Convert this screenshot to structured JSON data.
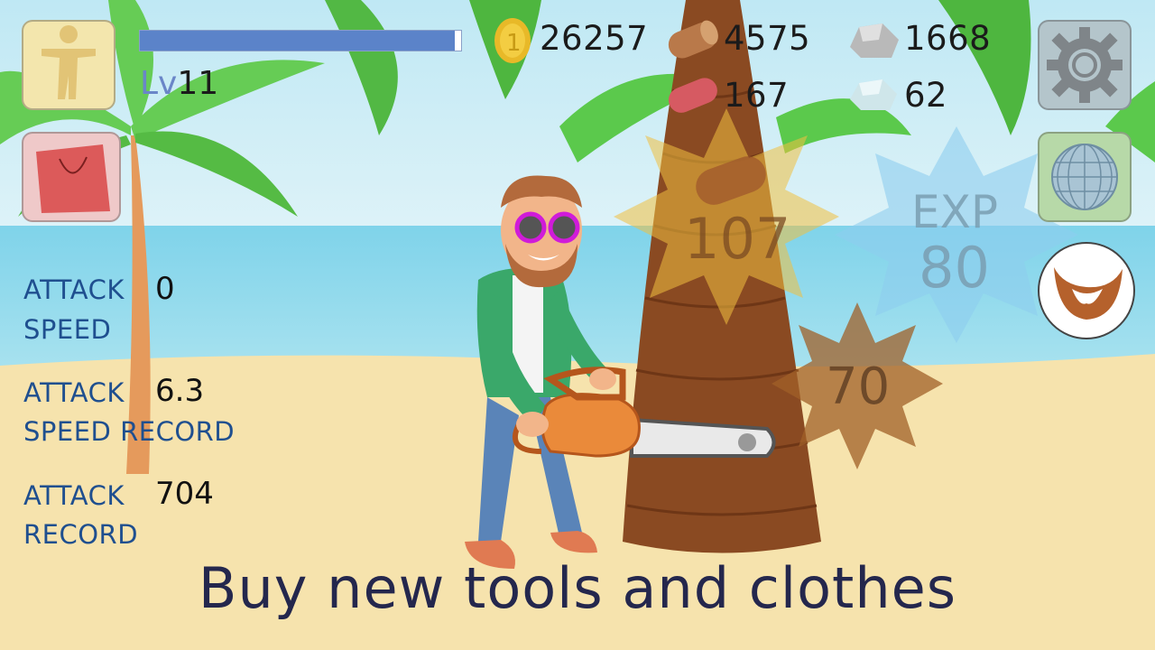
{
  "player": {
    "level_prefix": "Lv",
    "level": "11",
    "exp_fill": 0.98
  },
  "resources": {
    "coins": "26257",
    "wood": "4575",
    "stone": "1668",
    "red_wood": "167",
    "crystal": "62"
  },
  "stats": {
    "attack_speed_label_1": "ATTACK",
    "attack_speed_label_2": "SPEED",
    "attack_speed_value": "0",
    "speed_record_label_1": "ATTACK",
    "speed_record_label_2": "SPEED RECORD",
    "speed_record_value": "6.3",
    "attack_record_label_1": "ATTACK",
    "attack_record_label_2": "RECORD",
    "attack_record_value": "704"
  },
  "popups": {
    "damage_main": "107",
    "exp_label": "EXP",
    "exp_value": "80",
    "damage_secondary": "70"
  },
  "caption": "Buy new tools and clothes",
  "icons": {
    "character": "character-icon",
    "shop": "shopping-bag-icon",
    "settings": "gear-icon",
    "map": "globe-icon",
    "beard": "beard-icon"
  }
}
